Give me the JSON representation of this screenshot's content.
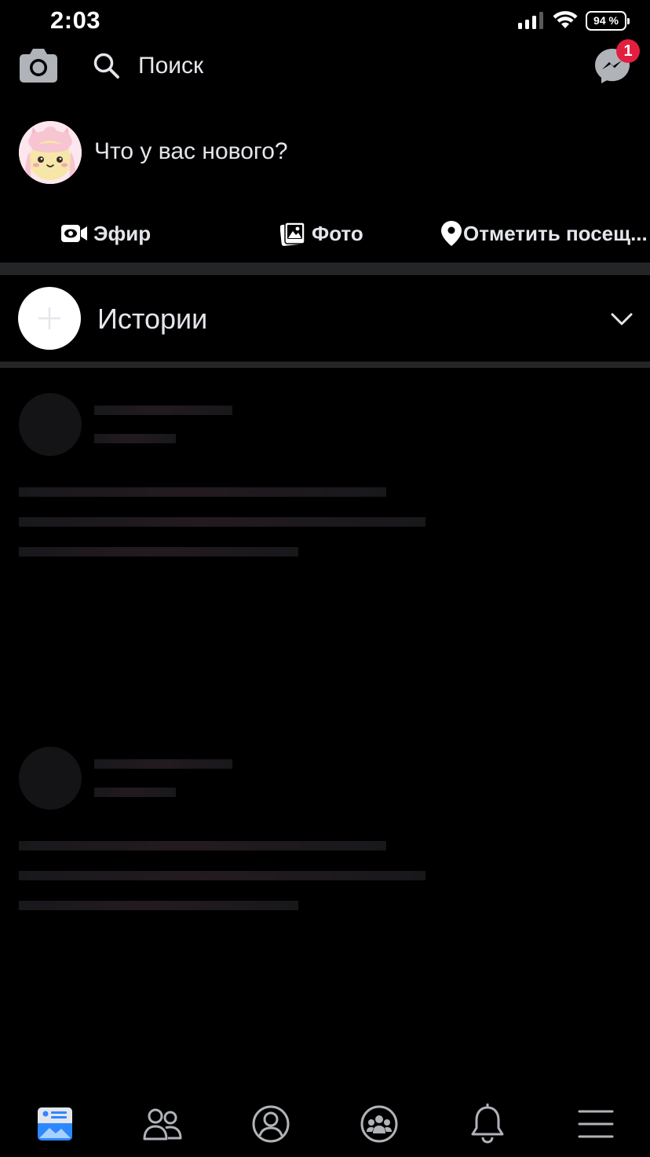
{
  "status_bar": {
    "time": "2:03",
    "battery": "94 %"
  },
  "header": {
    "search_label": "Поиск",
    "messenger_badge": "1"
  },
  "composer": {
    "prompt": "Что у вас нового?",
    "actions": [
      {
        "label": "Эфир",
        "icon": "live-video-icon"
      },
      {
        "label": "Фото",
        "icon": "photo-icon"
      },
      {
        "label": "Отметить посещ...",
        "icon": "location-pin-icon"
      }
    ]
  },
  "stories": {
    "title": "Истории"
  },
  "tabbar": {
    "items": [
      {
        "name": "news-feed",
        "icon": "news-feed-icon",
        "active": true
      },
      {
        "name": "friends",
        "icon": "friends-icon",
        "active": false
      },
      {
        "name": "profile",
        "icon": "profile-icon",
        "active": false
      },
      {
        "name": "groups",
        "icon": "groups-icon",
        "active": false
      },
      {
        "name": "notifications",
        "icon": "bell-icon",
        "active": false
      },
      {
        "name": "menu",
        "icon": "hamburger-menu-icon",
        "active": false
      }
    ]
  },
  "colors": {
    "background": "#000000",
    "text": "#e4e6eb",
    "divider": "#242526",
    "badge": "#e41e3f",
    "active_tab": "#2d88ff"
  }
}
